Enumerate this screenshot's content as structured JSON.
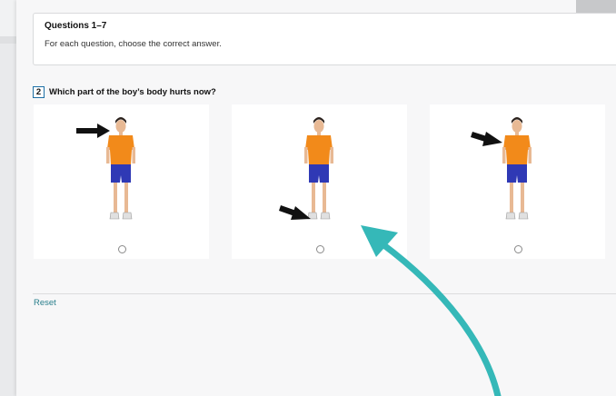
{
  "header": {
    "title": "Questions 1–7",
    "instruction": "For each question, choose the correct answer."
  },
  "question": {
    "number": "2",
    "text": "Which part of the boy’s body hurts now?"
  },
  "options": [
    {
      "id": "A",
      "target": "head",
      "selected": false
    },
    {
      "id": "B",
      "target": "foot",
      "selected": false
    },
    {
      "id": "C",
      "target": "shoulder",
      "selected": false
    }
  ],
  "actions": {
    "reset_label": "Reset"
  },
  "colors": {
    "shirt": "#f28a1a",
    "shorts": "#2f39b5",
    "accent_link": "#2a7f8c",
    "annotation_arrow": "#35b8b8"
  }
}
